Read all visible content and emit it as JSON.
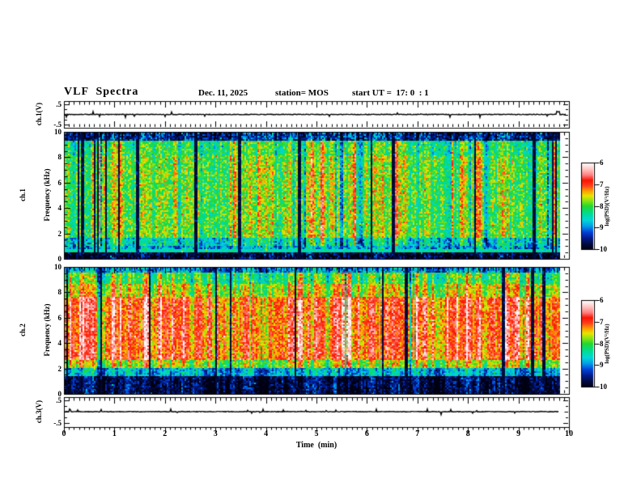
{
  "header": {
    "title": "VLF  Spectra",
    "date": "Dec. 11, 2025",
    "station": "station= MOS",
    "start_ut": "start UT =  17: 0  : 1"
  },
  "x_axis": {
    "label": "Time  (min)",
    "ticks": [
      "0",
      "1",
      "2",
      "3",
      "4",
      "5",
      "6",
      "7",
      "8",
      "9",
      "10"
    ],
    "range": [
      0,
      10
    ],
    "minor_step_min": 0.1,
    "data_end_min": 9.84
  },
  "colorbar": {
    "label": "log(PSD)(V²/Hz)",
    "ticks": [
      "-6",
      "-7",
      "-8",
      "-9",
      "-10"
    ],
    "value_top": -6,
    "value_bottom": -10,
    "colormap_stops": [
      [
        0.0,
        "#000012"
      ],
      [
        0.06,
        "#000a3c"
      ],
      [
        0.13,
        "#001a8a"
      ],
      [
        0.2,
        "#0040d8"
      ],
      [
        0.27,
        "#009ce8"
      ],
      [
        0.34,
        "#00d8d8"
      ],
      [
        0.42,
        "#00dc90"
      ],
      [
        0.5,
        "#22d830"
      ],
      [
        0.56,
        "#86e414"
      ],
      [
        0.62,
        "#e8e400"
      ],
      [
        0.68,
        "#ff9800"
      ],
      [
        0.74,
        "#ff3c1e"
      ],
      [
        0.8,
        "#fa1400"
      ],
      [
        0.86,
        "#ff8080"
      ],
      [
        0.93,
        "#ffc8c4"
      ],
      [
        1.0,
        "#ffffff"
      ]
    ]
  },
  "chart_data": [
    {
      "id": "ch1_waveform",
      "type": "line",
      "label": "ch.1(V)",
      "yticks": [
        ".5",
        "-.5"
      ],
      "ytick_values": [
        0.5,
        -0.5
      ],
      "ylim": [
        -0.64,
        0.64
      ],
      "baseline_v": 0,
      "spike_prob": 0.02,
      "spike_bias_down": 0.7,
      "end_spike": true,
      "description": "Quiet voltage trace at ~0 V across 0-9.8 min with sporadic 1-3 px spikes and an upward blip at the end"
    },
    {
      "id": "ch1_spectrogram",
      "type": "heatmap",
      "label_line1": "ch.1",
      "label_line2": "Frequency (kHz)",
      "yticks": [
        "0",
        "2",
        "4",
        "6",
        "8",
        "10"
      ],
      "ylim": [
        0,
        10
      ],
      "xlim": [
        0,
        10
      ],
      "value_label": "log(PSD)(V²/Hz)",
      "value_range": [
        -10,
        -6
      ],
      "bands": [
        [
          0,
          0.5,
          0.04
        ],
        [
          0.5,
          0.72,
          0.1
        ],
        [
          0.72,
          1.05,
          0.3
        ],
        [
          1.05,
          1.7,
          0.36
        ],
        [
          1.7,
          8.2,
          0.52
        ],
        [
          8.2,
          9.3,
          0.46
        ],
        [
          9.3,
          10,
          0.15
        ]
      ],
      "line_freq": 0.6,
      "noise": 0.26,
      "dropout_prob": 0.055,
      "hot_prob": 0.09,
      "cold_prob": 0.06,
      "col_walk": 0.16,
      "description": "Green/cyan broadband noise 1.5-9.5 kHz with yellow-red hot columns, many narrow black dropout columns, dark band below ~0.9 kHz with a thin bright line near 0.6 kHz, dark blue band above ~9.4 kHz"
    },
    {
      "id": "ch2_spectrogram",
      "type": "heatmap",
      "label_line1": "ch.2",
      "label_line2": "Frequency (kHz)",
      "yticks": [
        "0",
        "2",
        "4",
        "6",
        "8",
        "10"
      ],
      "ylim": [
        0,
        10
      ],
      "xlim": [
        0,
        10
      ],
      "value_label": "log(PSD)(V²/Hz)",
      "value_range": [
        -10,
        -6
      ],
      "bands": [
        [
          0,
          1.35,
          0.06
        ],
        [
          1.35,
          2.1,
          0.3
        ],
        [
          2.1,
          2.7,
          0.55
        ],
        [
          2.7,
          7.6,
          0.73
        ],
        [
          7.6,
          8.6,
          0.58
        ],
        [
          8.6,
          9.5,
          0.47
        ],
        [
          9.5,
          10,
          0.26
        ]
      ],
      "line_freq": 0,
      "noise": 0.22,
      "dropout_prob": 0.045,
      "hot_prob": 0.12,
      "cold_prob": 0.05,
      "col_walk": 0.14,
      "description": "Intense red/orange band 2.5-7.5 kHz with green cold columns and black dropouts, green above 8 kHz, dark speckled band below ~1.4 kHz"
    },
    {
      "id": "ch3_waveform",
      "type": "line",
      "label": "ch.3(V)",
      "yticks": [
        ".5",
        "-.5"
      ],
      "ytick_values": [
        0.5,
        -0.5
      ],
      "ylim": [
        -0.7,
        0.66
      ],
      "baseline_v": 0,
      "spike_prob": 0.03,
      "spike_bias_down": 0.3,
      "end_spike": false,
      "description": "Quiet voltage trace at ~0 V with sporadic small upward spikes, ending near 9.8 min"
    }
  ]
}
